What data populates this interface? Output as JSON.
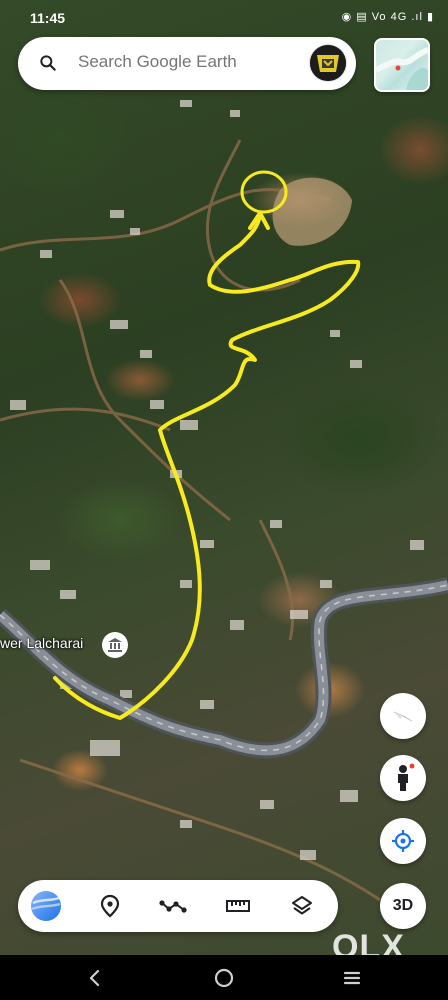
{
  "status_bar": {
    "time": "11:45",
    "icons_text": "◉ ▤ Vo 4G .ıl ▮"
  },
  "search": {
    "placeholder": "Search Google Earth"
  },
  "map": {
    "place_label": "wer Lalcharai",
    "watermark": "OLX"
  },
  "controls": {
    "compass": "compass-icon",
    "street_view": "pegman-icon",
    "my_location": "my-location-icon",
    "view_3d_label": "3D"
  },
  "toolbar": {
    "items": [
      "earth-logo-icon",
      "place-pin-icon",
      "path-icon",
      "ruler-icon",
      "layers-icon"
    ]
  },
  "nav": {
    "items": [
      "back-icon",
      "home-icon",
      "recents-icon"
    ]
  },
  "colors": {
    "annotation": "#f7ea1e",
    "road": "#8a8f97",
    "accent": "#1a73e8"
  }
}
